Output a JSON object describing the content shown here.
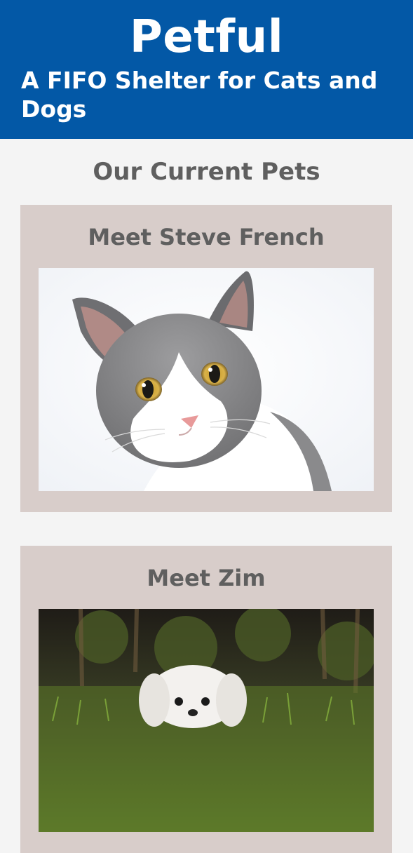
{
  "header": {
    "title": "Petful",
    "subtitle": "A FIFO Shelter for Cats and Dogs"
  },
  "main": {
    "section_title": "Our Current Pets",
    "pets": [
      {
        "name": "Meet Steve French",
        "photo": "cat-photo"
      },
      {
        "name": "Meet Zim",
        "photo": "dog-photo"
      }
    ]
  },
  "colors": {
    "header_bg": "#0358a6",
    "page_bg": "#f4f4f4",
    "card_bg": "#d8cdca",
    "heading_text": "#5f5f5f"
  }
}
